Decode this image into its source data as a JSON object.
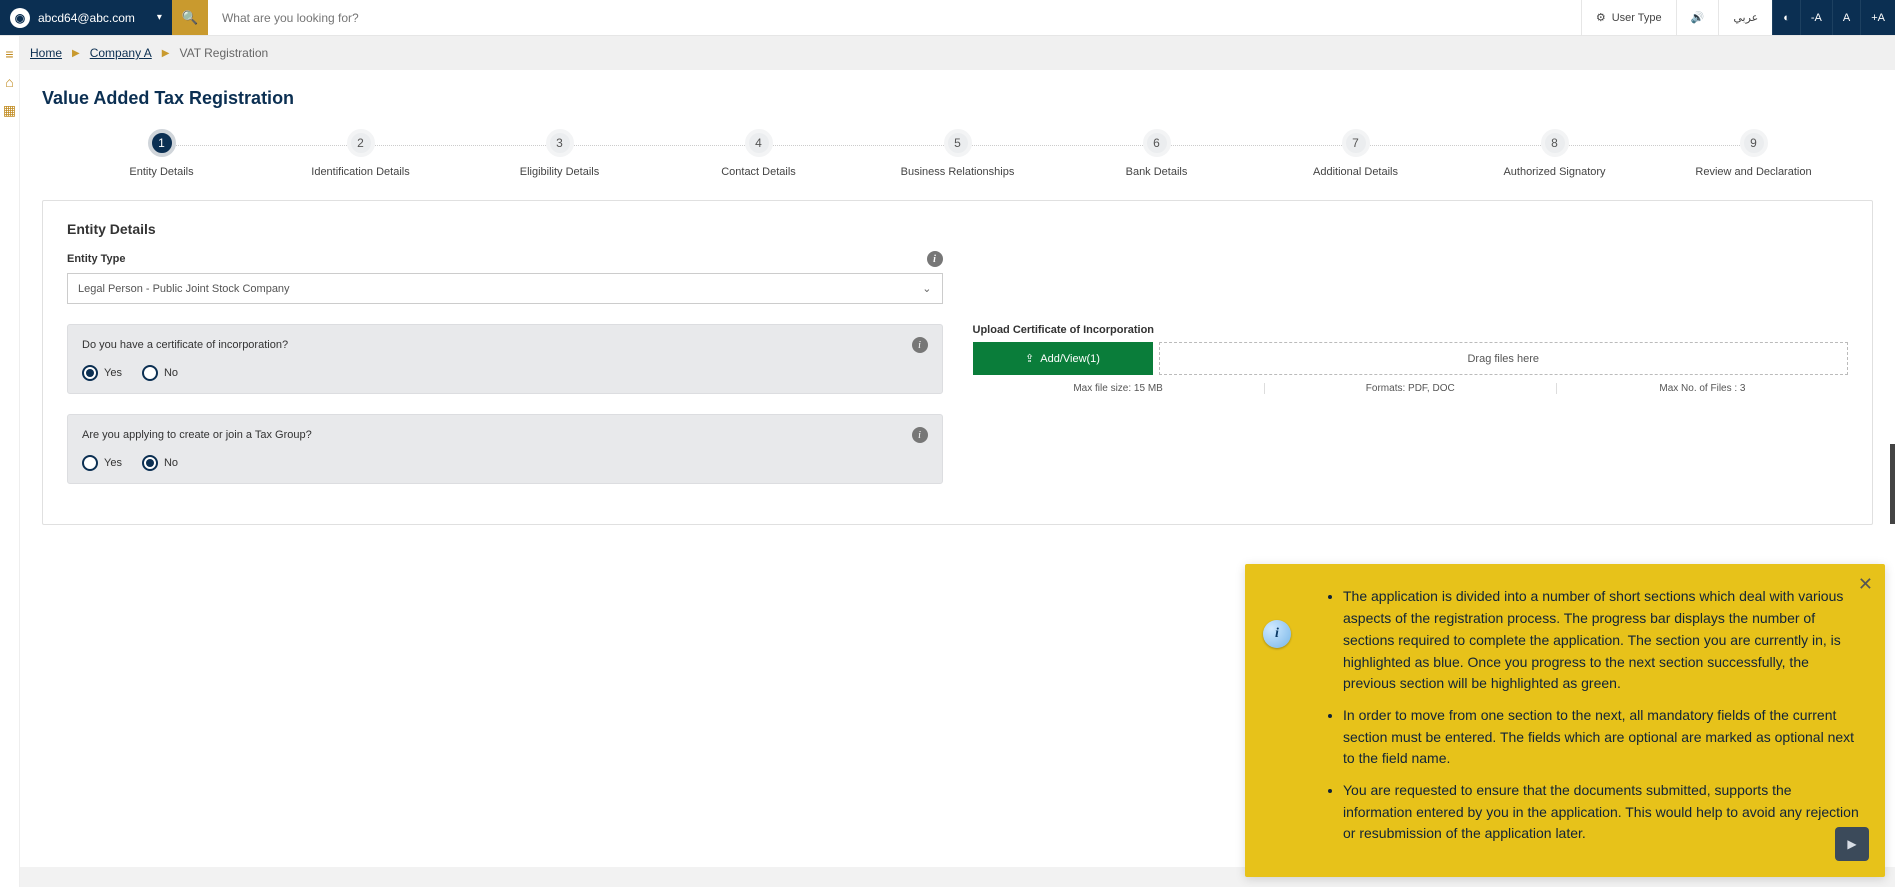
{
  "header": {
    "user_email": "abcd64@abc.com",
    "search_placeholder": "What are you looking for?",
    "user_type": "User Type",
    "lang": "عربي",
    "font_dec": "-A",
    "font_norm": "A",
    "font_inc": "+A"
  },
  "breadcrumb": {
    "home": "Home",
    "company": "Company A",
    "current": "VAT Registration"
  },
  "page": {
    "title": "Value Added Tax Registration"
  },
  "steps": [
    {
      "num": "1",
      "label": "Entity Details",
      "active": true
    },
    {
      "num": "2",
      "label": "Identification Details",
      "active": false
    },
    {
      "num": "3",
      "label": "Eligibility Details",
      "active": false
    },
    {
      "num": "4",
      "label": "Contact Details",
      "active": false
    },
    {
      "num": "5",
      "label": "Business Relationships",
      "active": false
    },
    {
      "num": "6",
      "label": "Bank Details",
      "active": false
    },
    {
      "num": "7",
      "label": "Additional Details",
      "active": false
    },
    {
      "num": "8",
      "label": "Authorized Signatory",
      "active": false
    },
    {
      "num": "9",
      "label": "Review and Declaration",
      "active": false
    }
  ],
  "panel": {
    "title": "Entity Details",
    "entity_type_label": "Entity Type",
    "entity_type_value": "Legal Person - Public Joint Stock Company",
    "q1": {
      "text": "Do you have a certificate of incorporation?",
      "yes": "Yes",
      "no": "No",
      "selected": "yes"
    },
    "q2": {
      "text": "Are you applying to create or join a Tax Group?",
      "yes": "Yes",
      "no": "No",
      "selected": "no"
    },
    "upload": {
      "label": "Upload Certificate of Incorporation",
      "button": "Add/View(1)",
      "drag": "Drag files here",
      "max_size": "Max file size: 15 MB",
      "formats": "Formats: PDF, DOC",
      "max_no": "Max No. of Files : 3"
    }
  },
  "floater": {
    "bullets": [
      "The application is divided into a number of short sections which deal with various aspects of the registration process. The progress bar displays the number of sections required to complete the application. The section you are currently in, is highlighted as blue. Once you progress to the next section successfully, the previous section will be highlighted as green.",
      "In order to move from one section to the next, all mandatory fields of the current section must be entered. The fields which are optional are marked as optional next to the field name.",
      "You are requested to ensure that the documents submitted, supports the information entered by you in the application. This would help to avoid any rejection or resubmission of the application later."
    ]
  }
}
